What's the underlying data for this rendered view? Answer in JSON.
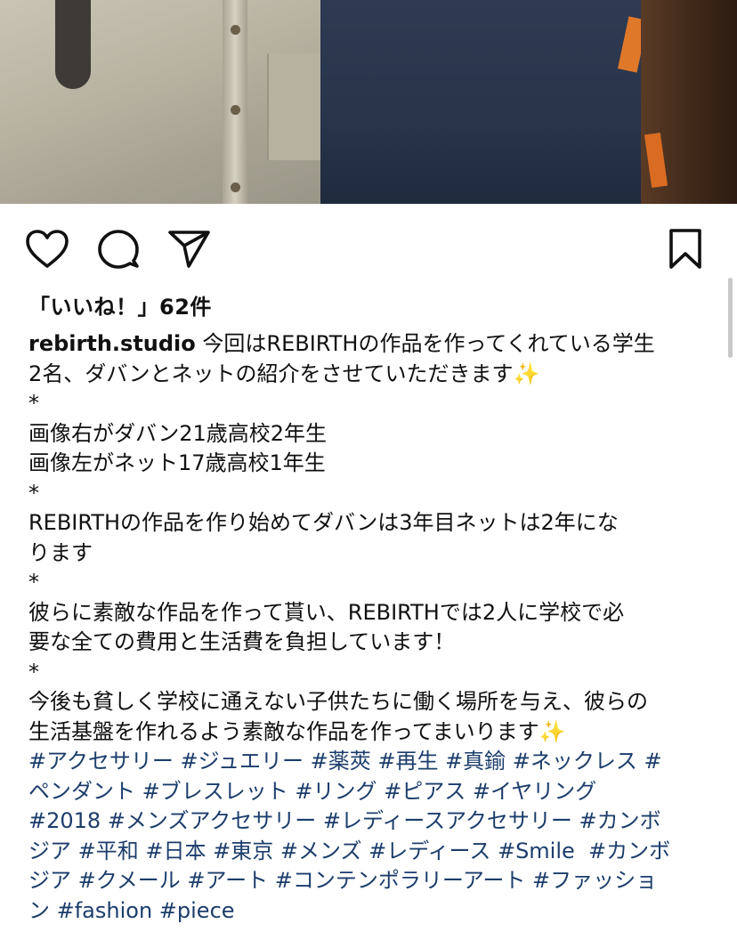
{
  "post": {
    "likes_text": "「いいね！」62件",
    "username": "rebirth.studio",
    "caption_lines": [
      "今回はREBIRTHの作品を作ってくれている学生",
      "2名、ダバンとネットの紹介をさせていただきます✨",
      "*",
      "画像右がダバン21歳高校2年生",
      "画像左がネット17歳高校1年生",
      "*",
      "REBIRTHの作品を作り始めてダバンは3年目ネットは2年にな",
      "ります",
      "*",
      "彼らに素敵な作品を作って貰い、REBIRTHでは2人に学校で必",
      "要な全ての費用と生活費を負担しています！",
      "*",
      "今後も貧しく学校に通えない子供たちに働く場所を与え、彼らの",
      "生活基盤を作れるよう素敵な作品を作ってまいります✨"
    ],
    "hashtag_lines": [
      "#アクセサリー #ジュエリー #薬莢 #再生 #真鍮 #ネックレス #",
      "ペンダント #ブレスレット #リング #ピアス #イヤリング",
      "#2018 #メンズアクセサリー #レディースアクセサリー #カンボ",
      "ジア #平和 #日本 #東京 #メンズ #レディース #Smile  #カンボ",
      "ジア #クメール #アート #コンテンポラリーアート #ファッショ",
      "ン #fashion #piece"
    ]
  },
  "icons": {
    "like": "heart-icon",
    "comment": "comment-bubble-icon",
    "share": "paper-plane-icon",
    "save": "bookmark-icon"
  },
  "colors": {
    "hashtag": "#1c3d6b",
    "text": "#111111",
    "background": "#ffffff"
  }
}
